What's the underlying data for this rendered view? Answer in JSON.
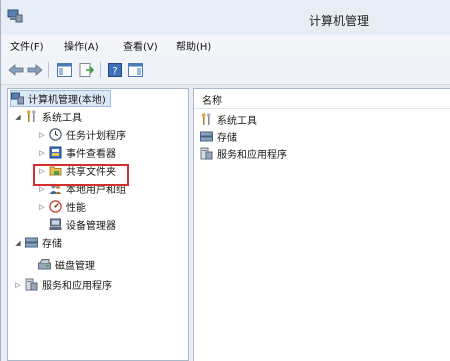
{
  "window": {
    "title": "计算机管理"
  },
  "menu": [
    {
      "label": "文件(F)"
    },
    {
      "label": "操作(A)"
    },
    {
      "label": "查看(V)"
    },
    {
      "label": "帮助(H)"
    }
  ],
  "toolbar": {
    "buttons": [
      "back-arrow-icon",
      "forward-arrow-icon",
      "console-tree-icon",
      "export-list-icon",
      "help-icon",
      "properties-icon"
    ]
  },
  "tree": {
    "root": "计算机管理(本地)",
    "system_tools": "系统工具",
    "task_scheduler": "任务计划程序",
    "event_viewer": "事件查看器",
    "shared_folders": "共享文件夹",
    "local_users": "本地用户和组",
    "performance": "性能",
    "device_manager": "设备管理器",
    "storage": "存储",
    "disk_management": "磁盘管理",
    "services_apps": "服务和应用程序"
  },
  "list": {
    "header": "名称",
    "items": [
      "系统工具",
      "存储",
      "服务和应用程序"
    ]
  },
  "colors": {
    "highlight_box": "#d32f2f",
    "selection": "#dce8f6"
  }
}
